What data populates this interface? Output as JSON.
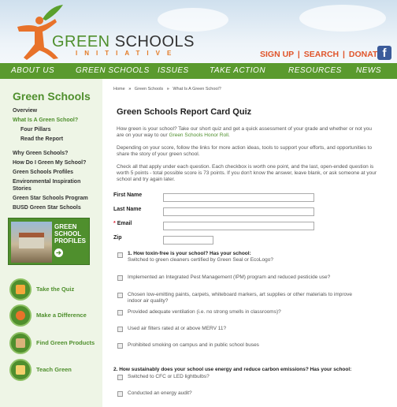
{
  "header": {
    "logo_green": "GREEN",
    "logo_schools": "SCHOOLS",
    "logo_initiative": "INITIATIVE",
    "top_links": [
      "SIGN UP",
      "SEARCH",
      "DONATE"
    ],
    "separator": "|",
    "facebook_glyph": "f",
    "accent": "#e0552a",
    "brand_green": "#4f8f2d"
  },
  "nav": {
    "items": [
      "ABOUT US",
      "GREEN SCHOOLS",
      "ISSUES",
      "TAKE ACTION",
      "RESOURCES",
      "NEWS"
    ]
  },
  "sidebar": {
    "title": "Green Schools",
    "items": [
      "Overview",
      "What Is A Green School?",
      "Four Pillars",
      "Read the Report",
      "Why Green Schools?",
      "How Do I Green My School?",
      "Green Schools Profiles",
      "Environmental Inspiration Stories",
      "Green Star Schools Program",
      "BUSD Green Star Schools"
    ],
    "promo": [
      "GREEN",
      "SCHOOL",
      "PROFILES"
    ],
    "promo_arrow": "➔",
    "actions": [
      "Take the Quiz",
      "Make a Difference",
      "Find Green Products",
      "Teach Green"
    ]
  },
  "main": {
    "breadcrumb": [
      "Home",
      "Green Schools",
      "What Is A Green School?"
    ],
    "breadcrumb_sep": "»",
    "title": "Green Schools Report Card Quiz",
    "intro1": "How green is your school? Take our short quiz and get a quick assessment of your grade and whether or not you are on your way to our ",
    "intro1_link": "Green Schools Honor Roll",
    "intro1_end": ".",
    "intro2": "Depending on your score, follow the links for more action ideas, tools to support your efforts, and opportunities to share the story of your green school.",
    "intro3": "Check all that apply under each question. Each checkbox is worth one point, and the last, open-ended question is worth 5 points - total possible score is 73 points. If you don't know the answer, leave blank, or ask someone at your school and try again later.",
    "form": {
      "first_name": "First Name",
      "last_name": "Last Name",
      "email": "Email",
      "zip": "Zip",
      "required_mark": "*",
      "first_name_value": "",
      "last_name_value": "",
      "email_value": "",
      "zip_value": ""
    },
    "q1_title": "1. How toxin-free is your school? Has your school:",
    "q1_options": [
      "Switched to green cleaners certified by Green Seal or EcoLogo?",
      "Implemented an Integrated Pest Management (IPM) program and reduced pesticide use?",
      "Chosen low-emitting paints, carpets, whiteboard markers, art supplies or other materials to improve indoor air quality?",
      "Provided adequate ventilation (i.e. no strong smells in classrooms)?",
      "Used air filters rated at or above MERV 11?",
      "Prohibited smoking on campus and in public school buses"
    ],
    "q2_title": "2. How sustainably does your school use energy and reduce carbon emissions? Has your school:",
    "q2_options": [
      "Switched to CFC or LED lightbulbs?",
      "Conducted an energy audit?"
    ]
  }
}
